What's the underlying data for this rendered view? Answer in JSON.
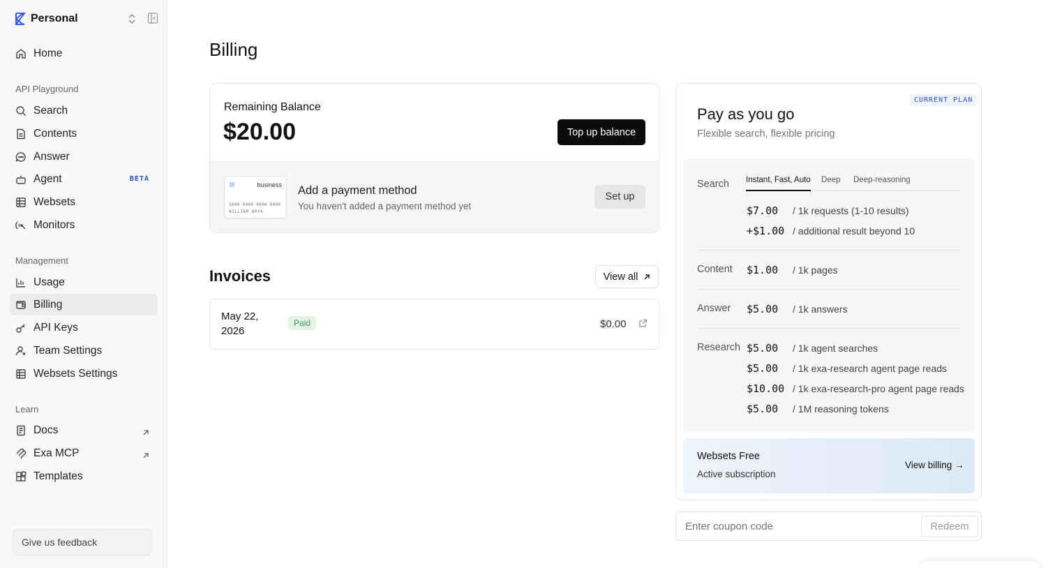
{
  "workspace": {
    "name": "Personal"
  },
  "nav": {
    "home": "Home",
    "section_api": "API Playground",
    "search": "Search",
    "contents": "Contents",
    "answer": "Answer",
    "agent": "Agent",
    "agent_badge": "BETA",
    "websets": "Websets",
    "monitors": "Monitors",
    "section_management": "Management",
    "usage": "Usage",
    "billing": "Billing",
    "api_keys": "API Keys",
    "team_settings": "Team Settings",
    "websets_settings": "Websets Settings",
    "section_learn": "Learn",
    "docs": "Docs",
    "exa_mcp": "Exa MCP",
    "templates": "Templates",
    "feedback": "Give us feedback"
  },
  "page": {
    "title": "Billing"
  },
  "balance": {
    "label": "Remaining Balance",
    "amount": "$20.00",
    "top_up": "Top up balance",
    "card_brand": "business",
    "card_number": "1000 0000 0000 0000",
    "card_holder": "WILLIAM BRYK",
    "payment_title": "Add a payment method",
    "payment_sub": "You haven't added a payment method yet",
    "setup": "Set up"
  },
  "invoices": {
    "title": "Invoices",
    "view_all": "View all",
    "rows": [
      {
        "date": "May 22, 2026",
        "status": "Paid",
        "amount": "$0.00"
      }
    ]
  },
  "plan": {
    "badge": "CURRENT PLAN",
    "title": "Pay as you go",
    "subtitle": "Flexible search, flexible pricing",
    "search": {
      "label": "Search",
      "tabs": [
        "Instant, Fast, Auto",
        "Deep",
        "Deep-reasoning"
      ],
      "rows": [
        {
          "price": "$7.00",
          "desc": "/ 1k requests (1-10 results)"
        },
        {
          "price": "+$1.00",
          "desc": "/ additional result beyond 10"
        }
      ]
    },
    "content": {
      "label": "Content",
      "price": "$1.00",
      "desc": "/ 1k pages"
    },
    "answer": {
      "label": "Answer",
      "price": "$5.00",
      "desc": "/ 1k answers"
    },
    "research": {
      "label": "Research",
      "rows": [
        {
          "price": "$5.00",
          "desc": "/ 1k agent searches"
        },
        {
          "price": "$5.00",
          "desc": "/ 1k exa-research agent page reads"
        },
        {
          "price": "$10.00",
          "desc": "/ 1k exa-research-pro agent page reads"
        },
        {
          "price": "$5.00",
          "desc": "/ 1M reasoning tokens"
        }
      ]
    },
    "websets": {
      "title": "Websets Free",
      "subtitle": "Active subscription",
      "link": "View billing →"
    }
  },
  "coupon": {
    "placeholder": "Enter coupon code",
    "redeem": "Redeem"
  },
  "colors": {
    "accent": "#2b4fd6",
    "paid_bg": "#e3f4e7",
    "paid_text": "#3c9a5a"
  }
}
